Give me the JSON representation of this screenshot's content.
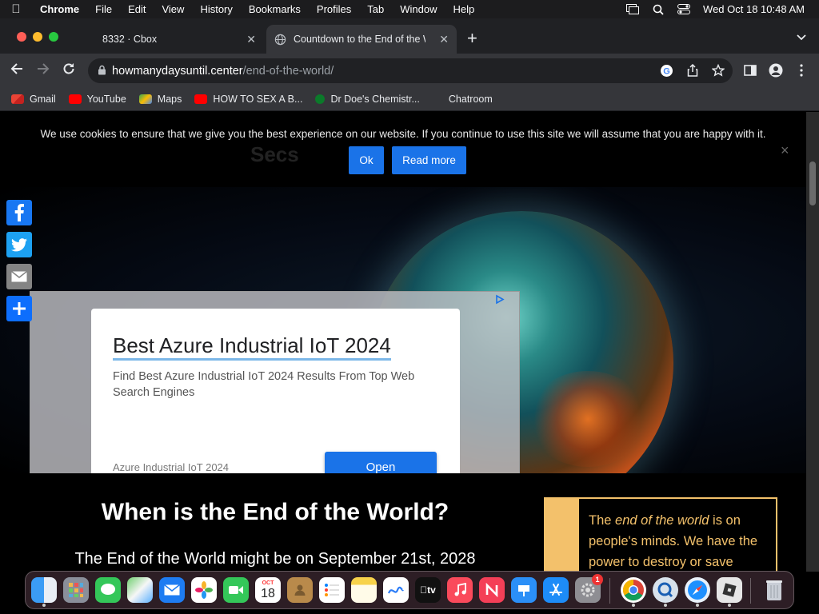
{
  "menubar": {
    "app": "Chrome",
    "items": [
      "File",
      "Edit",
      "View",
      "History",
      "Bookmarks",
      "Profiles",
      "Tab",
      "Window",
      "Help"
    ],
    "datetime": "Wed Oct 18  10:48 AM"
  },
  "tabs": [
    {
      "title": "8332 · Cbox",
      "active": false
    },
    {
      "title": "Countdown to the End of the W",
      "active": true
    }
  ],
  "address": {
    "host": "howmanydaysuntil.center",
    "path": "/end-of-the-world/"
  },
  "bookmarks": [
    "Gmail",
    "YouTube",
    "Maps",
    "HOW TO SEX A B...",
    "Dr Doe's Chemistr...",
    "Chatroom"
  ],
  "cookie": {
    "message": "We use cookies to ensure that we give you the best experience on our website. If you continue to use this site we will assume that you are happy with it.",
    "ok": "Ok",
    "read_more": "Read more",
    "close": "×",
    "ghost_text": "Secs"
  },
  "ad": {
    "headline": "Best Azure Industrial IoT 2024",
    "description": "Find Best Azure Industrial IoT 2024 Results From Top Web Search Engines",
    "advertiser": "Azure Industrial IoT 2024",
    "cta": "Open"
  },
  "content": {
    "heading": "When is the End of the World?",
    "subheading": "The End of the World might be on September 21st, 2028",
    "quote_pre": "The ",
    "quote_em": "end of the world",
    "quote_post": " is on people's minds. We have the power to destroy or save"
  },
  "dock": {
    "calendar_month": "OCT",
    "calendar_day": "18",
    "settings_badge": "1",
    "apple_tv": "tv"
  },
  "colors": {
    "accent_blue": "#1a73e8",
    "quote_gold": "#f3c16b"
  }
}
